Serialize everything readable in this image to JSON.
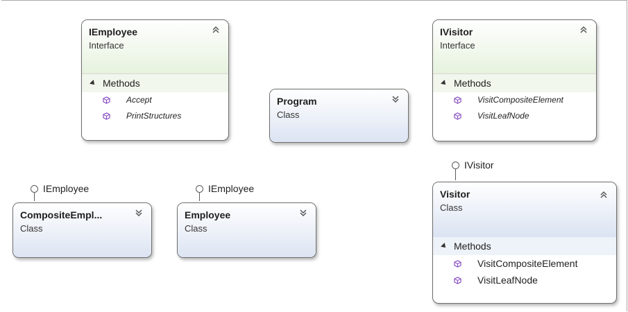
{
  "shapes": {
    "iemployee": {
      "name": "IEmployee",
      "kind": "Interface",
      "section": "Methods",
      "methods": [
        "Accept",
        "PrintStructures"
      ]
    },
    "program": {
      "name": "Program",
      "kind": "Class"
    },
    "ivisitor": {
      "name": "IVisitor",
      "kind": "Interface",
      "section": "Methods",
      "methods": [
        "VisitCompositeElement",
        "VisitLeafNode"
      ]
    },
    "composite": {
      "name": "CompositeEmpl...",
      "kind": "Class",
      "interface": "IEmployee"
    },
    "employee": {
      "name": "Employee",
      "kind": "Class",
      "interface": "IEmployee"
    },
    "visitor": {
      "name": "Visitor",
      "kind": "Class",
      "interface": "IVisitor",
      "section": "Methods",
      "methods": [
        "VisitCompositeElement",
        "VisitLeafNode"
      ]
    }
  },
  "colors": {
    "interface_header": "#e6f2de",
    "class_header": "#dbe3f2",
    "method_icon": "#8a4fc3",
    "border": "#6e6e6e"
  },
  "icons": {
    "collapse": "double-chevron-up-icon",
    "expand": "double-chevron-down-icon",
    "method": "method-cube-icon",
    "interface": "lollipop-interface-icon"
  }
}
